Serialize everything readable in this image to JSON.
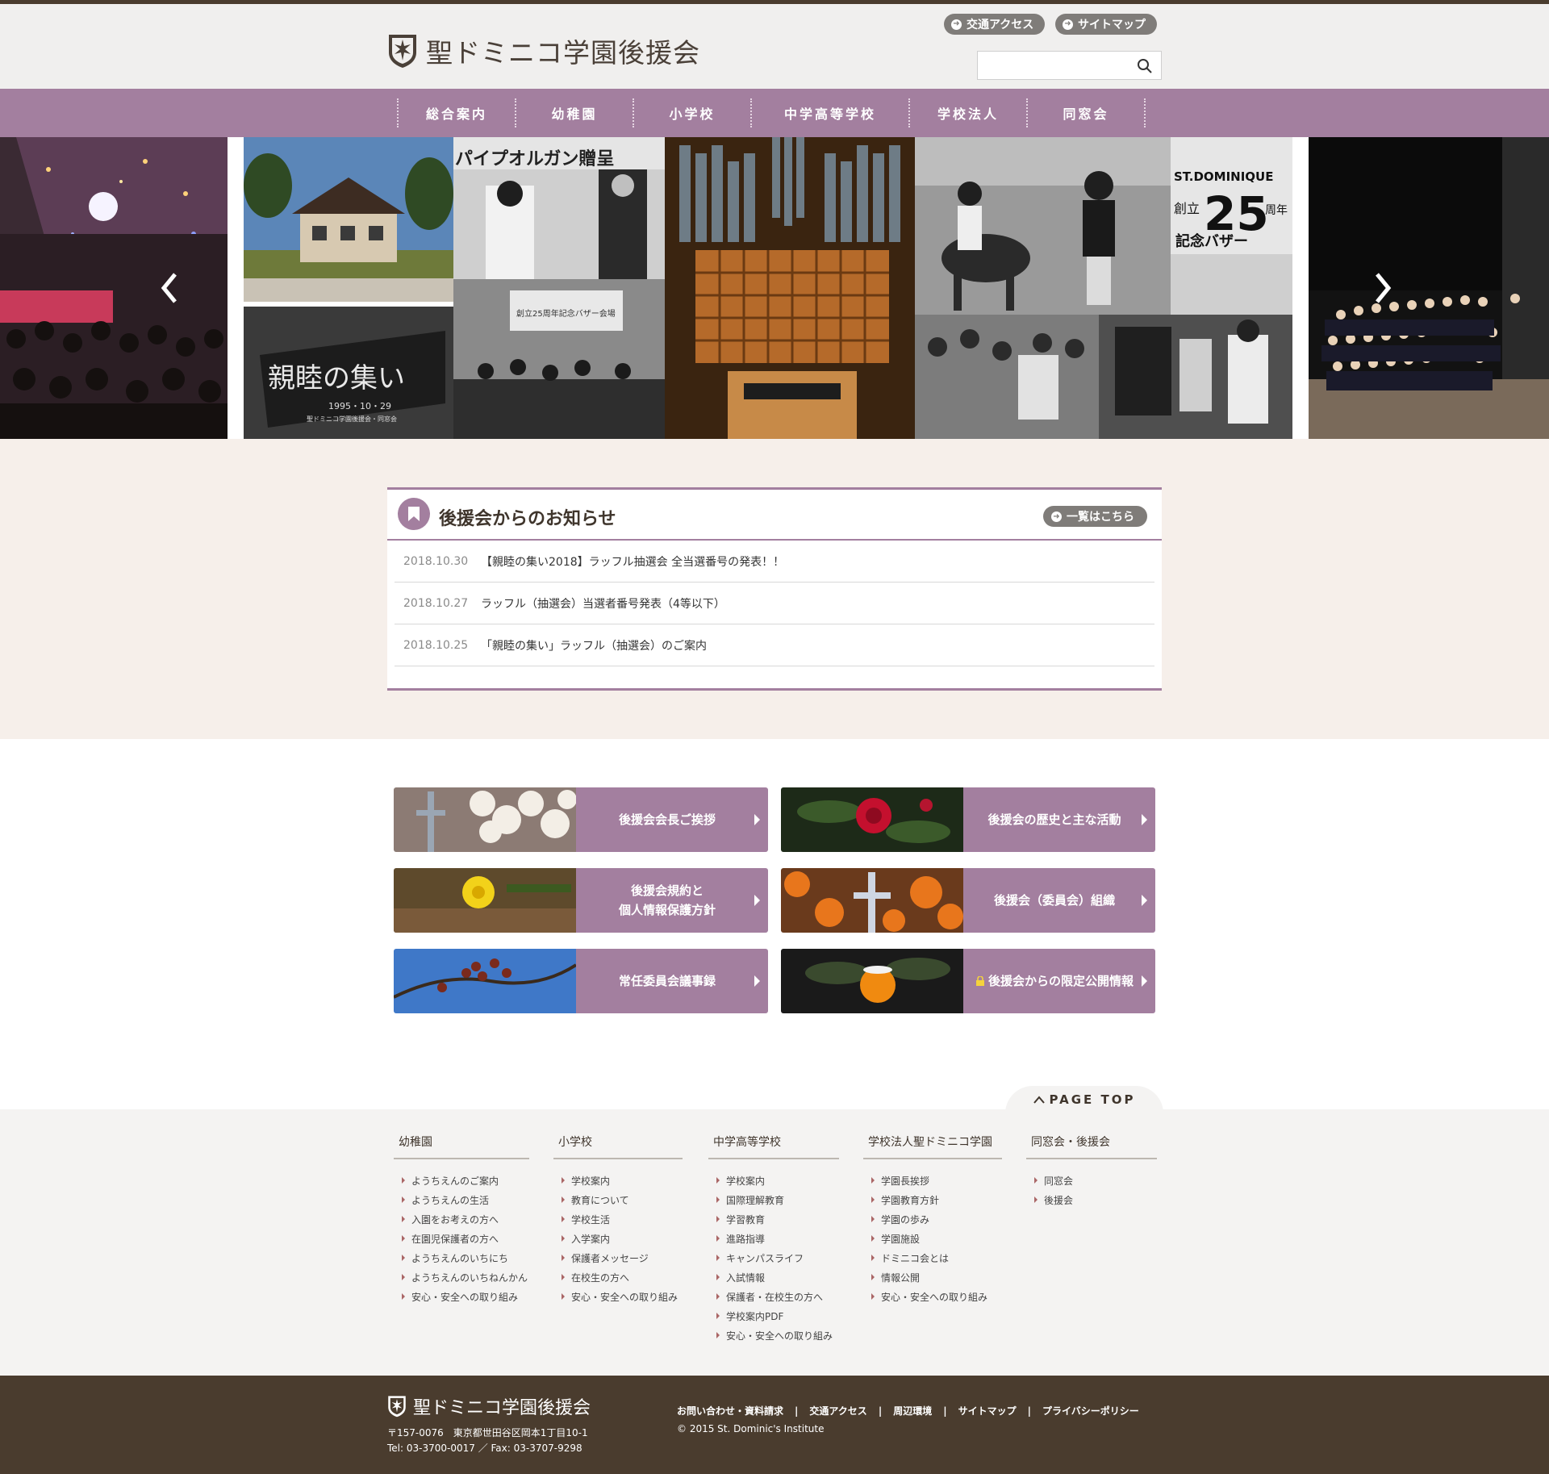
{
  "header": {
    "logo_text": "聖ドミニコ学園後援会",
    "util_links": [
      "交通アクセス",
      "サイトマップ"
    ],
    "search_placeholder": ""
  },
  "nav": {
    "items": [
      "総合案内",
      "幼稚園",
      "小学校",
      "中学高等学校",
      "学校法人",
      "同窓会"
    ]
  },
  "slider": {
    "caption_texts": [
      "親睦の集い",
      "1995・10・29",
      "聖ドミニコ学園後援会・同窓会",
      "パイプオルガン贈呈",
      "創立25周年記念バザー会場",
      "ST.DOMINIQUE",
      "創立",
      "25",
      "周年",
      "記念バザー"
    ]
  },
  "news": {
    "title": "後援会からのお知らせ",
    "more_label": "一覧はこちら",
    "items": [
      {
        "date": "2018.10.30",
        "text": "【親睦の集い2018】ラッフル抽選会 全当選番号の発表！！"
      },
      {
        "date": "2018.10.27",
        "text": "ラッフル（抽選会）当選者番号発表（4等以下）"
      },
      {
        "date": "2018.10.25",
        "text": "「親睦の集い」ラッフル（抽選会）のご案内"
      }
    ]
  },
  "cards": [
    {
      "label": "後援会会長ご挨拶"
    },
    {
      "label": "後援会の歴史と主な活動"
    },
    {
      "label": "後援会規約と\n個人情報保護方針"
    },
    {
      "label": "後援会（委員会）組織"
    },
    {
      "label": "常任委員会議事録"
    },
    {
      "label": "後援会からの限定公開情報",
      "icon": "lock-icon"
    }
  ],
  "page_top": "PAGE TOP",
  "footer_links": [
    {
      "heading": "幼稚園",
      "items": [
        "ようちえんのご案内",
        "ようちえんの生活",
        "入園をお考えの方へ",
        "在園児保護者の方へ",
        "ようちえんのいちにち",
        "ようちえんのいちねんかん",
        "安心・安全への取り組み"
      ]
    },
    {
      "heading": "小学校",
      "items": [
        "学校案内",
        "教育について",
        "学校生活",
        "入学案内",
        "保護者メッセージ",
        "在校生の方へ",
        "安心・安全への取り組み"
      ]
    },
    {
      "heading": "中学高等学校",
      "items": [
        "学校案内",
        "国際理解教育",
        "学習教育",
        "進路指導",
        "キャンパスライフ",
        "入試情報",
        "保護者・在校生の方へ",
        "学校案内PDF",
        "安心・安全への取り組み"
      ]
    },
    {
      "heading": "学校法人聖ドミニコ学園",
      "items": [
        "学園長挨拶",
        "学園教育方針",
        "学園の歩み",
        "学園施設",
        "ドミニコ会とは",
        "情報公開",
        "安心・安全への取り組み"
      ]
    },
    {
      "heading": "同窓会・後援会",
      "items": [
        "同窓会",
        "後援会"
      ]
    }
  ],
  "bottom_footer": {
    "logo_text": "聖ドミニコ学園後援会",
    "address": "〒157-0076　東京都世田谷区岡本1丁目10-1",
    "tel_fax": "Tel: 03-3700-0017 ／ Fax: 03-3707-9298",
    "links": [
      "お問い合わせ・資料請求",
      "交通アクセス",
      "周辺環境",
      "サイトマップ",
      "プライバシーポリシー"
    ],
    "copyright": "© 2015 St. Dominic's Institute"
  },
  "colors": {
    "accent_purple": "#a37f9f",
    "dark_brown": "#4a3c2e",
    "news_band": "#f6efea",
    "button_gray": "#7f7c79"
  }
}
